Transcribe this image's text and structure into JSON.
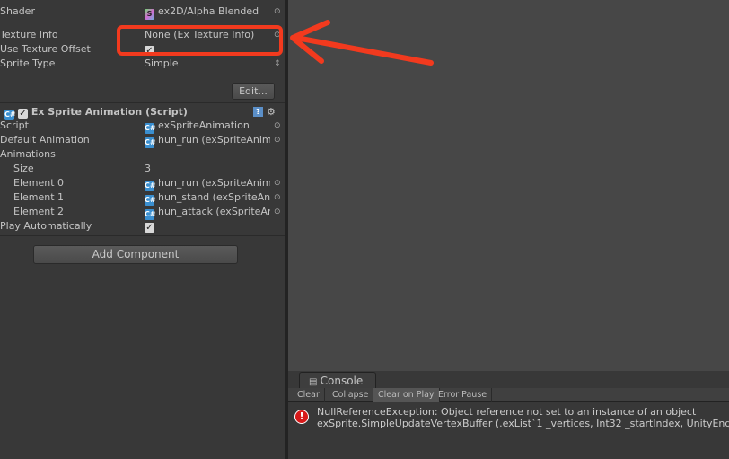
{
  "inspector": {
    "shader": {
      "label": "Shader",
      "value": "ex2D/Alpha Blended"
    },
    "texture_info": {
      "label": "Texture Info",
      "value": "None (Ex Texture Info)"
    },
    "use_texture_offset": {
      "label": "Use Texture Offset",
      "checked": true
    },
    "sprite_type": {
      "label": "Sprite Type",
      "value": "Simple"
    },
    "edit_button": "Edit...",
    "component": {
      "title": "Ex Sprite Animation (Script)",
      "enabled": true,
      "script": {
        "label": "Script",
        "value": "exSpriteAnimation"
      },
      "default_animation": {
        "label": "Default Animation",
        "value": "hun_run (exSpriteAnim"
      },
      "animations": {
        "label": "Animations",
        "size_label": "Size",
        "size": "3",
        "elements": [
          {
            "label": "Element 0",
            "value": "hun_run (exSpriteAnim"
          },
          {
            "label": "Element 1",
            "value": "hun_stand (exSpriteAn"
          },
          {
            "label": "Element 2",
            "value": "hun_attack (exSpriteAn"
          }
        ]
      },
      "play_automatically": {
        "label": "Play Automatically",
        "checked": true
      }
    },
    "add_component": "Add Component"
  },
  "console": {
    "tab": "Console",
    "toolbar": [
      "Clear",
      "Collapse",
      "Clear on Play",
      "Error Pause"
    ],
    "active": "Clear on Play",
    "message": {
      "line1": "NullReferenceException: Object reference not set to an instance of an object",
      "line2": "exSprite.SimpleUpdateVertexBuffer (.exList`1 _vertices, Int32 _startIndex, UnityEngine"
    }
  },
  "annotation_color": "#f23a1e"
}
